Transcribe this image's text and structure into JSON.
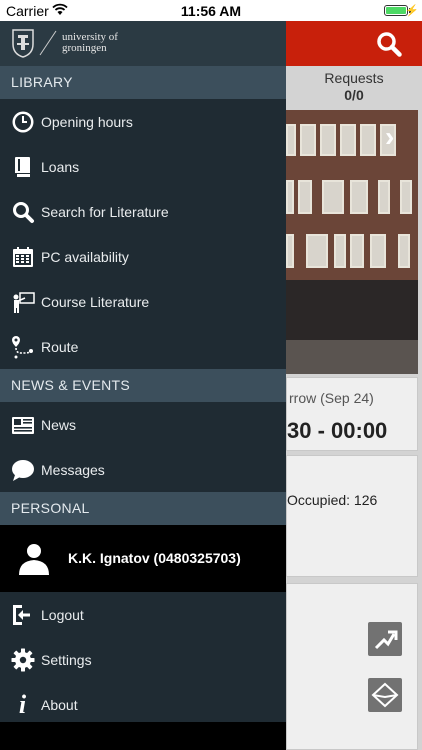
{
  "status_bar": {
    "carrier": "Carrier",
    "time": "11:56 AM"
  },
  "brand": {
    "line1": "university of",
    "line2": "groningen"
  },
  "background": {
    "requests_label": "Requests",
    "requests_value": "0/0",
    "tomorrow_text": "rrow (Sep 24)",
    "hours_text": "30 - 00:00",
    "occupied_text": "Occupied: 126"
  },
  "sections": {
    "library": "LIBRARY",
    "news_events": "NEWS & EVENTS",
    "personal": "PERSONAL"
  },
  "library_items": [
    {
      "label": "Opening hours",
      "icon": "clock-icon"
    },
    {
      "label": "Loans",
      "icon": "book-icon"
    },
    {
      "label": "Search for Literature",
      "icon": "search-icon"
    },
    {
      "label": "PC availability",
      "icon": "calendar-icon"
    },
    {
      "label": "Course Literature",
      "icon": "presenter-icon"
    },
    {
      "label": "Route",
      "icon": "route-icon"
    }
  ],
  "news_items": [
    {
      "label": "News",
      "icon": "newspaper-icon"
    },
    {
      "label": "Messages",
      "icon": "chat-bubble-icon"
    }
  ],
  "user": {
    "name": "K.K.  Ignatov (0480325703)"
  },
  "personal_items": [
    {
      "label": "Logout",
      "icon": "logout-icon"
    },
    {
      "label": "Settings",
      "icon": "gear-icon"
    },
    {
      "label": "About",
      "icon": "info-icon"
    }
  ],
  "colors": {
    "accent_red": "#c8200b",
    "drawer_bg": "#1f2b33",
    "section_bg": "#3c4f5c"
  }
}
